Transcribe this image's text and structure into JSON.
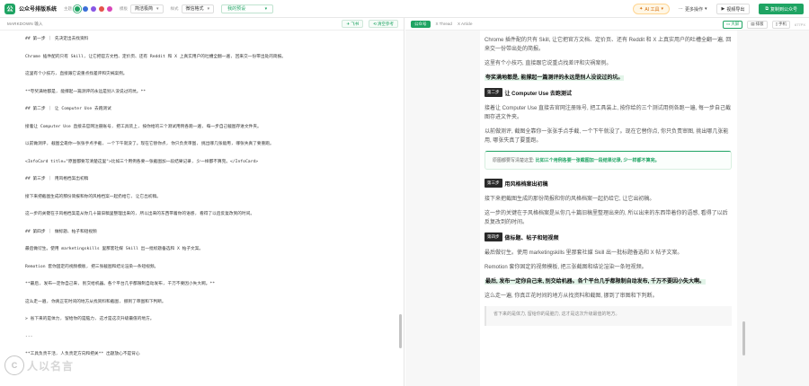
{
  "app": {
    "title": "公众号排版系统",
    "logo_glyph": "公"
  },
  "topbar": {
    "theme_label": "主题",
    "theme_colors": [
      "#1fa463",
      "#3c6fd8",
      "#8957e5",
      "#e5534b",
      "#d946b8"
    ],
    "style_label": "模板",
    "style_value": "简洁极简",
    "format_label": "样式",
    "format_value": "微信格式",
    "preset_value": "我的预设",
    "ai_tools": "AI 工具",
    "more_actions": "更多操作",
    "video_export": "视频导出",
    "copy_button": "复制到公众号"
  },
  "left": {
    "header": "MARKDOWN 输入",
    "btn_fly": "飞书",
    "btn_clear": "清空参考",
    "lines": [
      "## 第一步 ｜ 先决定出去找资料",
      "Chrome 插件配的只有 Skill, 让它把官方文档、定价页、还有 Reddit 和 X 上真实用户的吐槽全翻一遍, 回来交一份带出处的简报。",
      "这里有个小技巧, 直接跟它说重点找差评和灾祸案例。",
      "**夸奖满地都是, 能撑起一篇测评的永远是别人没说过的坑。**",
      "## 第二步 ｜ 让 Computer Use 去跑测试",
      "接着让 Computer Use 直接去官网注册账号, 把工具装上, 按你给的三个测试用例各跑一遍, 每一步自己截图存进文件夹。",
      "以前做测评, 截图全靠你一张张手点手截, 一个下午就没了。现在它替你点, 你只负责审图, 挑出哪几张能用, 哪张失真了要重跑。",
      "<InfoCard title=\"原图都要写清楚这里\">比如三个用例各要一张截图加一段结果记录, 少一样都不算完。</InfoCard>",
      "## 第三步 ｜ 用风格档案出初稿",
      "接下来把截图生成的那份简报和你的风格档案一起扔给它, 让它出初稿。",
      "这一步的关键在于风格档案是从你几十篇旧稿里整理出来的, 所以出来的东西带着你的语感, 看得了以后反复改到的时间。",
      "## 第四步 ｜ 做标题、帖子和短视频",
      "最后做衍生。使用 marketingskills 里那套社媒 Skill 出一批标题备选和 X 帖子文案。",
      "Remotion 套你固定的视频模板, 把三张截图和结论渲染一条短视频。",
      "**最后, 发布一定你自己来, 别交给机器。各个平台几乎都限制自动发布, 千万不要因小失大啊。**",
      "这么走一遍, 你真正花时间的地方从找资料和截图, 挪到了审图和下判断。",
      "> 省下来的是体力, 留给你的是脑力, 这才是这次升级最值的地方。",
      "---",
      "**工具负责干活, 人负责定方向和把关** 出题放心不是背心"
    ]
  },
  "right": {
    "tabs": [
      "公众号",
      "X Thread",
      "X Article"
    ],
    "btn_fill": "大屏",
    "btn_layout": "排版",
    "btn_mobile": "手机",
    "width_text": "677PX",
    "article": {
      "p1": "Chrome 插件配的只有 Skill, 让它把官方文档、定价页、还有 Reddit 和 X 上真实用户的吐槽全翻一遍, 回来交一份带出处的简报。",
      "p2": "这里有个小技巧, 直接跟它说重点找差评和灾祸案例。",
      "p3": "夸奖满地都是, 能撑起一篇测评的永远是别人没说过的坑。",
      "step2_tag": "第二步",
      "step2_title": "让 Computer Use 去跑测试",
      "p4": "接着让 Computer Use 直接去官网注册账号, 把工具装上, 按你给的三个测试用例各跑一遍, 每一步自己截图存进文件夹。",
      "p5": "以前做测评, 截图全靠你一张张手点手截, 一个下午就没了。现在它替你点, 你只负责审图, 挑出哪几张能用, 哪张失真了要重跑。",
      "info_prefix": "原图都要写清楚这里:",
      "info_strong": "比如三个用例各要一张截图加一段结果记录, 少一样都不算完。",
      "step3_tag": "第三步",
      "step3_title": "用风格档案出初稿",
      "p6": "接下来把截图生成的那份简报和你的风格档案一起扔给它, 让它出初稿。",
      "p7": "这一步的关键在于风格档案是从你几十篇旧稿里整理出来的, 所以出来的东西带着你的语感, 看得了以后反复改到的时间。",
      "step4_tag": "第四步",
      "step4_title": "做标题、帖子和短视频",
      "p8": "最后做衍生。使用 marketingskills 里那套社媒 Skill 出一批标题备选和 X 帖子文案。",
      "p9": "Remotion 套你固定的视频模板, 把三张截图和结论渲染一条短视频。",
      "p10": "最后, 发布一定你自己来, 别交给机器。各个平台几乎都限制自动发布, 千万不要因小失大啊。",
      "p11": "这么走一遍, 你真正花时间的地方从找资料和截图, 挪到了审图和下判断。",
      "quote": "省下来的是体力, 留给你的是脑力, 这才是这次升级最值的地方。"
    }
  },
  "watermark": {
    "glyph": "C",
    "text": "人以名言"
  }
}
